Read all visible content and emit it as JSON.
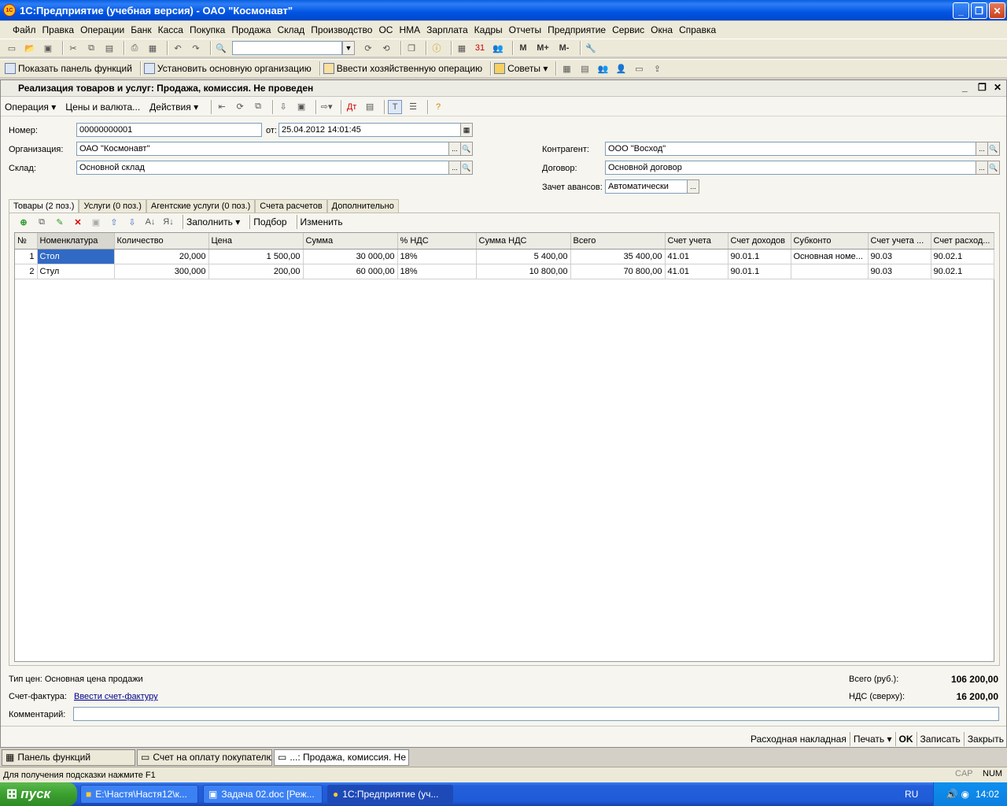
{
  "window": {
    "title": "1С:Предприятие (учебная версия) - ОАО \"Космонавт\""
  },
  "menu": [
    "Файл",
    "Правка",
    "Операции",
    "Банк",
    "Касса",
    "Покупка",
    "Продажа",
    "Склад",
    "Производство",
    "ОС",
    "НМА",
    "Зарплата",
    "Кадры",
    "Отчеты",
    "Предприятие",
    "Сервис",
    "Окна",
    "Справка"
  ],
  "toolbar2": {
    "show_panel": "Показать панель функций",
    "set_org": "Установить основную организацию",
    "enter_op": "Ввести хозяйственную операцию",
    "tips": "Советы"
  },
  "doc": {
    "title": "Реализация товаров и услуг: Продажа, комиссия. Не проведен",
    "menu": {
      "operation": "Операция",
      "prices": "Цены и валюта...",
      "actions": "Действия"
    },
    "fields": {
      "number_label": "Номер:",
      "number": "00000000001",
      "date_label": "от:",
      "date": "25.04.2012 14:01:45",
      "org_label": "Организация:",
      "org": "ОАО \"Космонавт\"",
      "warehouse_label": "Склад:",
      "warehouse": "Основной склад",
      "counterparty_label": "Контрагент:",
      "counterparty": "ООО \"Восход\"",
      "contract_label": "Договор:",
      "contract": "Основной договор",
      "advance_label": "Зачет авансов:",
      "advance": "Автоматически"
    },
    "tabs": [
      "Товары (2 поз.)",
      "Услуги (0 поз.)",
      "Агентские услуги (0 поз.)",
      "Счета расчетов",
      "Дополнительно"
    ],
    "grid_toolbar": {
      "fill": "Заполнить",
      "select": "Подбор",
      "change": "Изменить"
    },
    "columns": [
      "№",
      "Номенклатура",
      "Количество",
      "Цена",
      "Сумма",
      "% НДС",
      "Сумма НДС",
      "Всего",
      "Счет учета",
      "Счет доходов",
      "Субконто",
      "Счет учета ...",
      "Счет расход..."
    ],
    "rows": [
      [
        "1",
        "Стол",
        "20,000",
        "1 500,00",
        "30 000,00",
        "18%",
        "5 400,00",
        "35 400,00",
        "41.01",
        "90.01.1",
        "Основная номе...",
        "90.03",
        "90.02.1"
      ],
      [
        "2",
        "Стул",
        "300,000",
        "200,00",
        "60 000,00",
        "18%",
        "10 800,00",
        "70 800,00",
        "41.01",
        "90.01.1",
        "",
        "90.03",
        "90.02.1"
      ]
    ],
    "footer": {
      "price_type": "Тип цен: Основная цена продажи",
      "total_label": "Всего (руб.):",
      "total": "106 200,00",
      "vat_label": "НДС (сверху):",
      "vat": "16 200,00",
      "invoice_label": "Счет-фактура:",
      "invoice_link": "Ввести счет-фактуру",
      "comment_label": "Комментарий:"
    },
    "buttons": {
      "waybill": "Расходная накладная",
      "print": "Печать",
      "ok": "OK",
      "save": "Записать",
      "close": "Закрыть"
    }
  },
  "open_windows": [
    "Панель функций",
    "Счет на оплату покупателю",
    "...: Продажа, комиссия. Не ..."
  ],
  "status": {
    "hint": "Для получения подсказки нажмите F1",
    "cap": "CAP",
    "num": "NUM"
  },
  "taskbar": {
    "start": "пуск",
    "items": [
      "E:\\Настя\\Настя12\\к...",
      "Задача 02.doc [Реж...",
      "1С:Предприятие (уч..."
    ],
    "lang": "RU",
    "clock": "14:02"
  }
}
